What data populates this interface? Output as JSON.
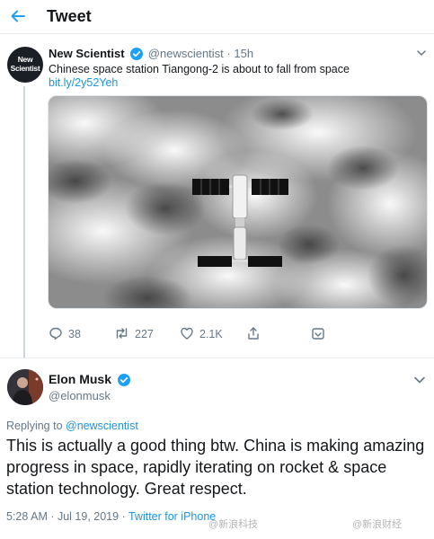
{
  "header": {
    "title": "Tweet",
    "back_icon": "arrow-left-icon"
  },
  "colors": {
    "accent": "#1b95e0",
    "verified": "#1da1f2",
    "secondary_text": "#657786"
  },
  "quoted_tweet": {
    "author": {
      "name": "New Scientist",
      "avatar_text_line1": "New",
      "avatar_text_line2": "Scientist",
      "verified": true
    },
    "handle": "@newscientist",
    "separator": "·",
    "time": "15h",
    "text": "Chinese space station Tiangong-2 is about to fall from space",
    "link": "bit.ly/2y52Yeh",
    "image_alt": "Tiangong-2 space station above clouds",
    "actions": [
      {
        "icon": "reply-icon",
        "count": "38"
      },
      {
        "icon": "retweet-icon",
        "count": "227"
      },
      {
        "icon": "like-icon",
        "count": "2.1K"
      },
      {
        "icon": "share-icon",
        "count": ""
      },
      {
        "icon": "analytics-icon",
        "count": ""
      }
    ]
  },
  "main_tweet": {
    "author": {
      "name": "Elon Musk",
      "verified": true
    },
    "handle": "@elonmusk",
    "replying_prefix": "Replying to",
    "replying_to": "@newscientist",
    "text": "This is actually a good thing btw. China is making amazing progress in space, rapidly iterating on rocket & space station technology. Great respect.",
    "timestamp": "5:28 AM · Jul 19, 2019 ·",
    "client": "Twitter for iPhone"
  },
  "watermarks": {
    "left": "@新浪科技",
    "right": "@新浪财经"
  }
}
